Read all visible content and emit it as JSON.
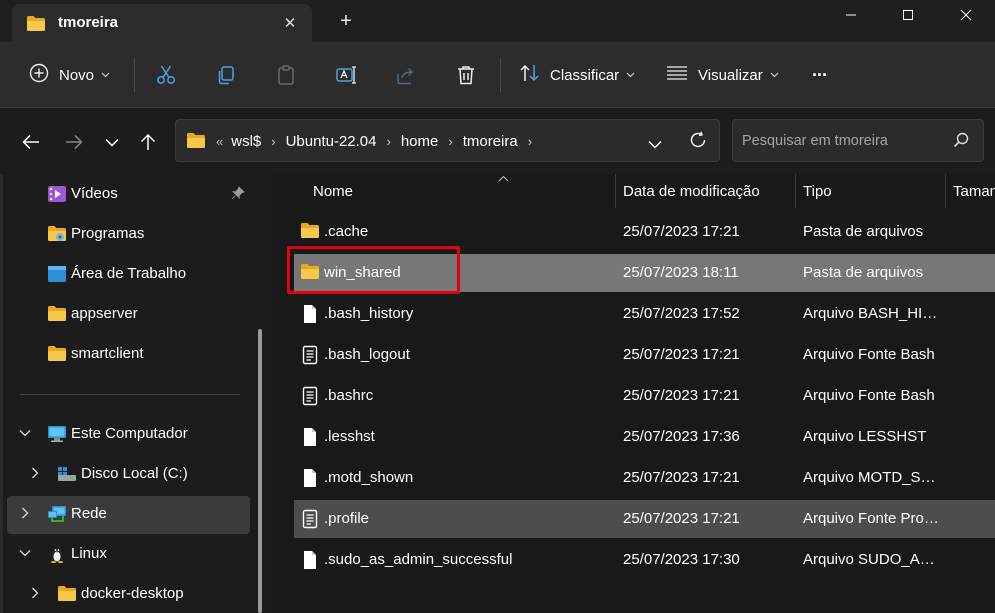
{
  "window": {
    "tab_title": "tmoreira",
    "tab_close_glyph": "✕",
    "new_tab_glyph": "+"
  },
  "toolbar": {
    "new_label": "Novo",
    "sort_label": "Classificar",
    "view_label": "Visualizar",
    "more_glyph": "···"
  },
  "address": {
    "overflow": "«",
    "crumbs": [
      "wsl$",
      "Ubuntu-22.04",
      "home",
      "tmoreira"
    ],
    "separator": "›"
  },
  "search": {
    "placeholder": "Pesquisar em tmoreira"
  },
  "nav": {
    "items": [
      {
        "label": "Vídeos",
        "icon": "videos-folder-icon"
      },
      {
        "label": "Programas",
        "icon": "programs-folder-icon"
      },
      {
        "label": "Área de Trabalho",
        "icon": "desktop-icon"
      },
      {
        "label": "appserver",
        "icon": "folder-icon"
      },
      {
        "label": "smartclient",
        "icon": "folder-icon"
      },
      {
        "label": "Este Computador",
        "icon": "computer-icon"
      },
      {
        "label": "Disco Local (C:)",
        "icon": "drive-icon"
      },
      {
        "label": "Rede",
        "icon": "network-icon"
      },
      {
        "label": "Linux",
        "icon": "linux-penguin-icon"
      },
      {
        "label": "docker-desktop",
        "icon": "folder-icon"
      }
    ]
  },
  "columns": {
    "name": "Nome",
    "date": "Data de modificação",
    "type": "Tipo",
    "size": "Taman"
  },
  "files": [
    {
      "name": ".cache",
      "date": "25/07/2023 17:21",
      "type": "Pasta de arquivos",
      "icon": "folder-icon"
    },
    {
      "name": "win_shared",
      "date": "25/07/2023 18:11",
      "type": "Pasta de arquivos",
      "icon": "folder-icon"
    },
    {
      "name": ".bash_history",
      "date": "25/07/2023 17:52",
      "type": "Arquivo BASH_HISTORY",
      "icon": "file-icon"
    },
    {
      "name": ".bash_logout",
      "date": "25/07/2023 17:21",
      "type": "Arquivo Fonte Bash",
      "icon": "text-file-icon"
    },
    {
      "name": ".bashrc",
      "date": "25/07/2023 17:21",
      "type": "Arquivo Fonte Bash",
      "icon": "text-file-icon"
    },
    {
      "name": ".lesshst",
      "date": "25/07/2023 17:36",
      "type": "Arquivo LESSHST",
      "icon": "file-icon"
    },
    {
      "name": ".motd_shown",
      "date": "25/07/2023 17:21",
      "type": "Arquivo MOTD_SHOWN",
      "icon": "file-icon"
    },
    {
      "name": ".profile",
      "date": "25/07/2023 17:21",
      "type": "Arquivo Fonte Profile",
      "icon": "text-file-icon"
    },
    {
      "name": ".sudo_as_admin_successful",
      "date": "25/07/2023 17:30",
      "type": "Arquivo SUDO_AS_ADMIN",
      "icon": "file-icon"
    }
  ],
  "colors": {
    "folder": "#f4c33b",
    "selection": "#777777",
    "highlight_box": "#e3000f",
    "accent": "#4aa3df"
  }
}
